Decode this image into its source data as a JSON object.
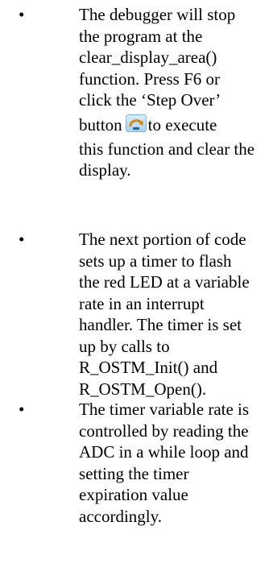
{
  "bullets": [
    {
      "symbol": "•",
      "line1": "The debugger will stop",
      "line2": "the program at the",
      "line3": "clear_display_area()",
      "line4": "function. Press F6 or",
      "line5": "click the ‘Step Over’",
      "line6a": "button",
      "icon": "step-over-icon",
      "line6b": "to execute",
      "line7": "this function and clear the",
      "line8": "display."
    },
    {
      "symbol": "•",
      "line1": "The next portion of code",
      "line2": "sets up a timer to flash",
      "line3": "the red LED at a variable",
      "line4": "rate in an interrupt",
      "line5": "handler. The timer is set",
      "line6": "up by calls to",
      "line7": "R_OSTM_Init() and",
      "line8": "R_OSTM_Open()."
    },
    {
      "symbol": "•",
      "line1": "The timer variable rate is",
      "line2": "controlled by reading the",
      "line3": "ADC in a while loop and",
      "line4": "setting the timer",
      "line5": "expiration value",
      "line6": "accordingly."
    }
  ]
}
